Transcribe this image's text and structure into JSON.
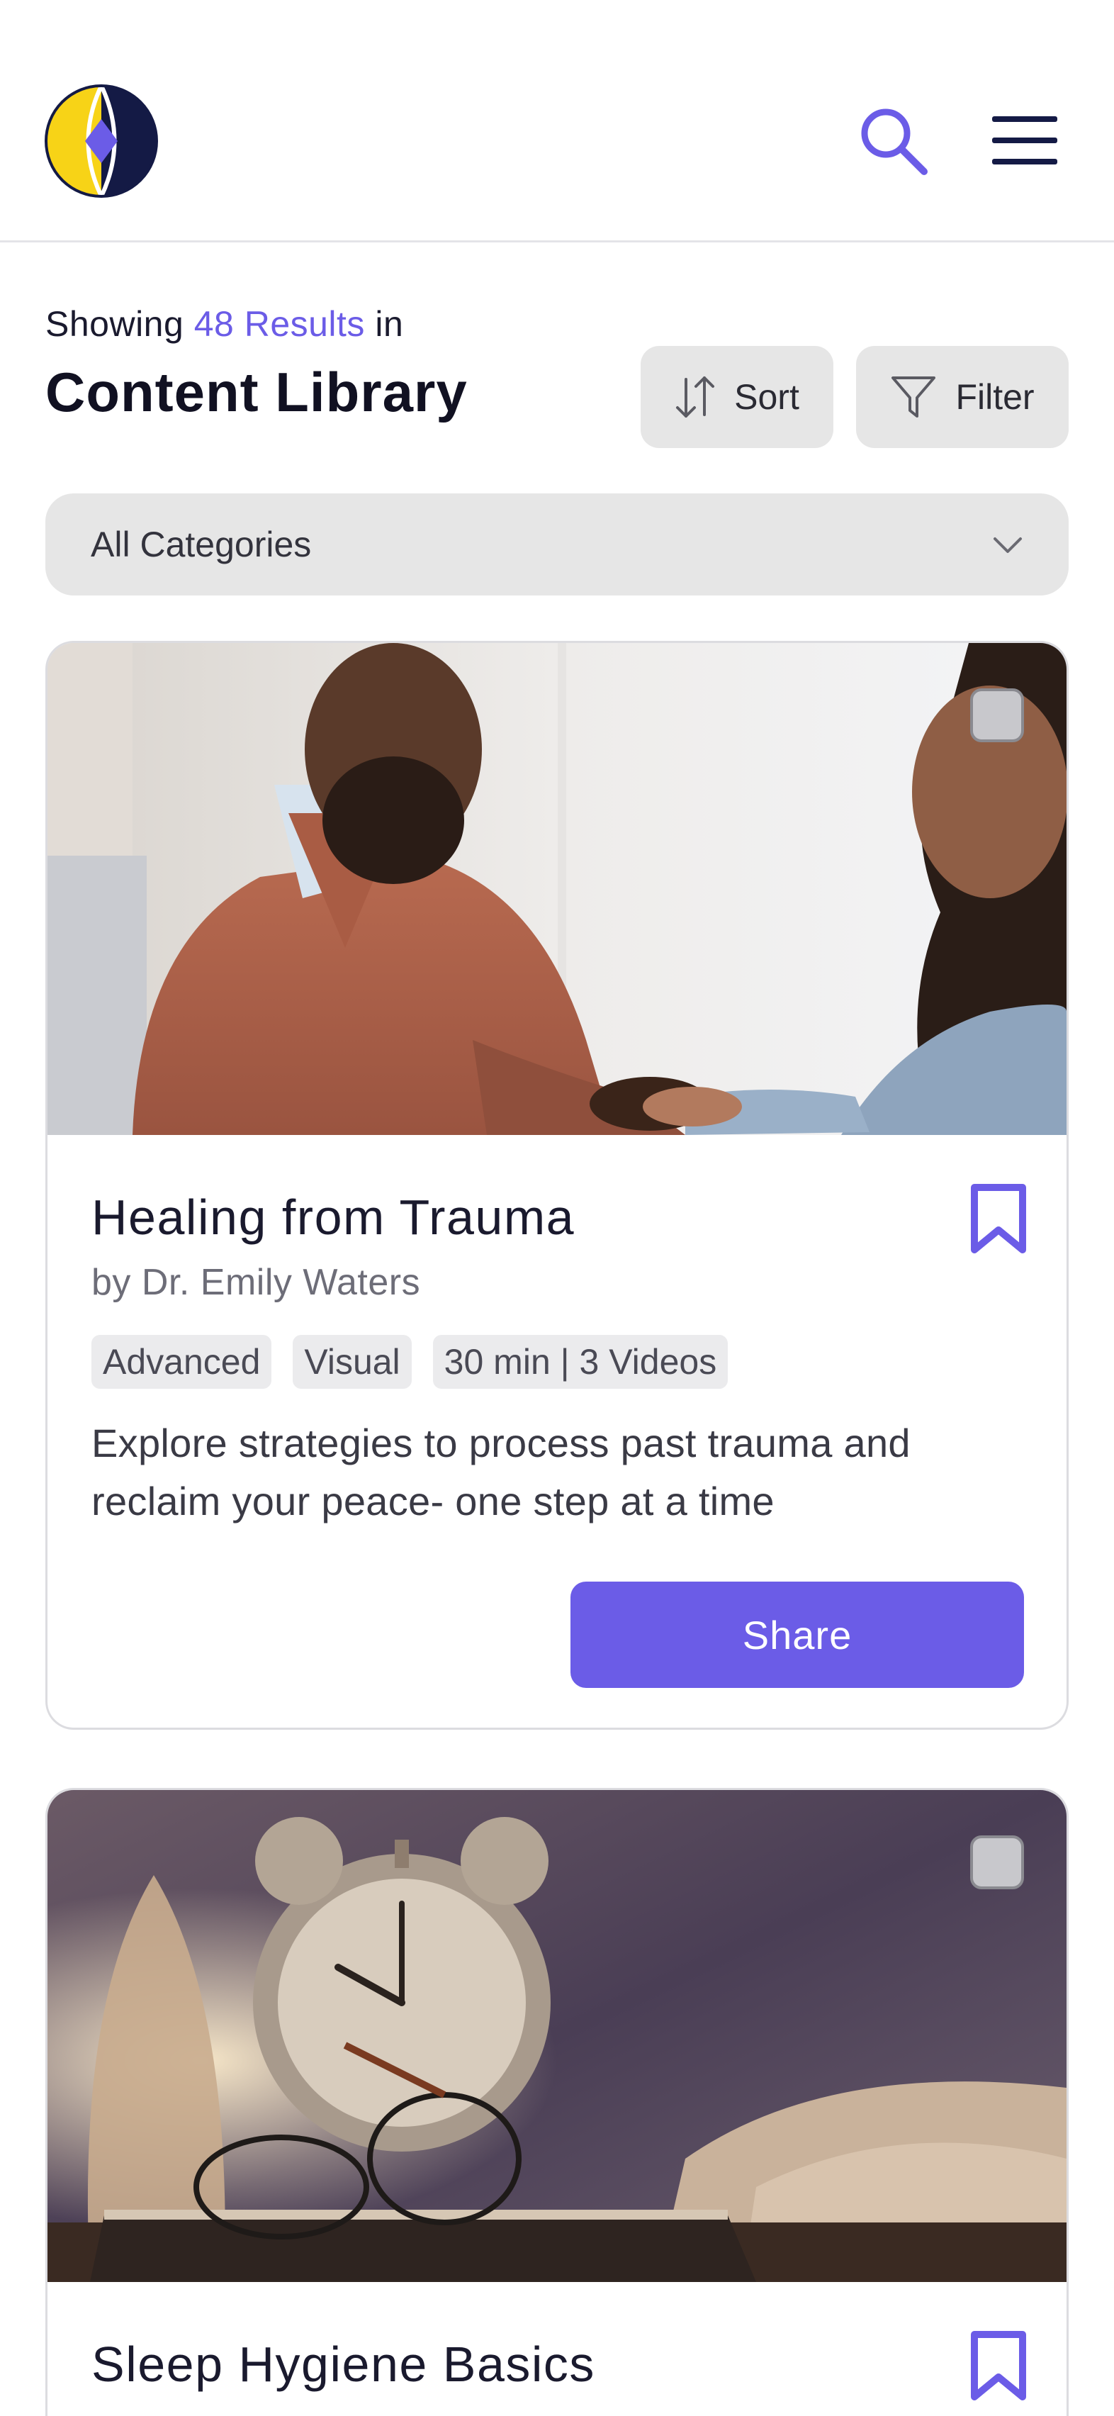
{
  "header": {
    "logo_icon": "brand-logo",
    "search_icon": "search-icon",
    "menu_icon": "hamburger-menu-icon"
  },
  "results": {
    "showing_prefix": "Showing",
    "count_text": "48 Results",
    "showing_suffix": "in",
    "title": "Content Library"
  },
  "toolbar": {
    "sort_label": "Sort",
    "filter_label": "Filter"
  },
  "category_filter": {
    "selected": "All Categories"
  },
  "cards": [
    {
      "title": "Healing from Trauma",
      "author": "by Dr. Emily Waters",
      "tags": [
        "Advanced",
        "Visual",
        "30 min | 3 Videos"
      ],
      "description": "Explore strategies to process past trauma and reclaim your peace- one step at a time",
      "share_label": "Share",
      "bookmarked": false
    },
    {
      "title": "Sleep Hygiene Basics",
      "bookmarked": false
    }
  ],
  "colors": {
    "accent": "#6b5ce7",
    "logo_yellow": "#f7d317",
    "logo_navy": "#141a45",
    "chip_bg": "#e6e6e6"
  }
}
